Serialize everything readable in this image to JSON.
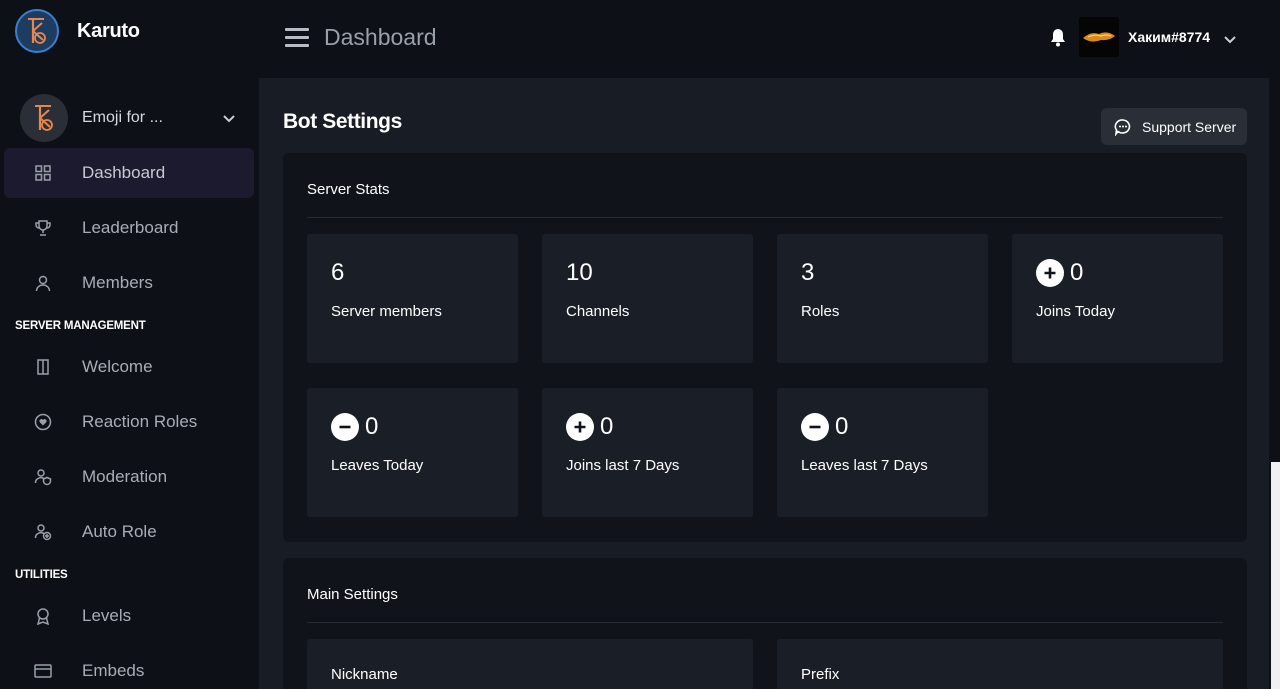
{
  "app": {
    "name": "Karuto"
  },
  "server": {
    "name": "Emoji for ..."
  },
  "nav": {
    "dashboard": "Dashboard",
    "leaderboard": "Leaderboard",
    "members": "Members",
    "section_server_management": "SERVER MANAGEMENT",
    "welcome": "Welcome",
    "reaction_roles": "Reaction Roles",
    "moderation": "Moderation",
    "auto_role": "Auto Role",
    "section_utilities": "UTILITIES",
    "levels": "Levels",
    "embeds": "Embeds"
  },
  "header": {
    "title": "Dashboard",
    "user_name": "Хаким#8774"
  },
  "main": {
    "title": "Bot Settings",
    "support_label": "Support Server",
    "server_stats": {
      "title": "Server Stats",
      "cards": [
        {
          "value": "6",
          "label": "Server members"
        },
        {
          "value": "10",
          "label": "Channels"
        },
        {
          "value": "3",
          "label": "Roles"
        },
        {
          "value": "0",
          "label": "Joins Today",
          "badge": "plus-icon"
        },
        {
          "value": "0",
          "label": "Leaves Today",
          "badge": "minus-icon"
        },
        {
          "value": "0",
          "label": "Joins last 7 Days",
          "badge": "plus-icon"
        },
        {
          "value": "0",
          "label": "Leaves last 7 Days",
          "badge": "minus-icon"
        }
      ]
    },
    "main_settings": {
      "title": "Main Settings",
      "nickname_label": "Nickname",
      "prefix_label": "Prefix"
    }
  },
  "colors": {
    "background": "#0d1016",
    "main_background": "#181c24",
    "panel": "#10141a",
    "card": "#1a1f27",
    "active_nav": "#1c1a2e",
    "brand_circle": "#3c7fcf"
  }
}
